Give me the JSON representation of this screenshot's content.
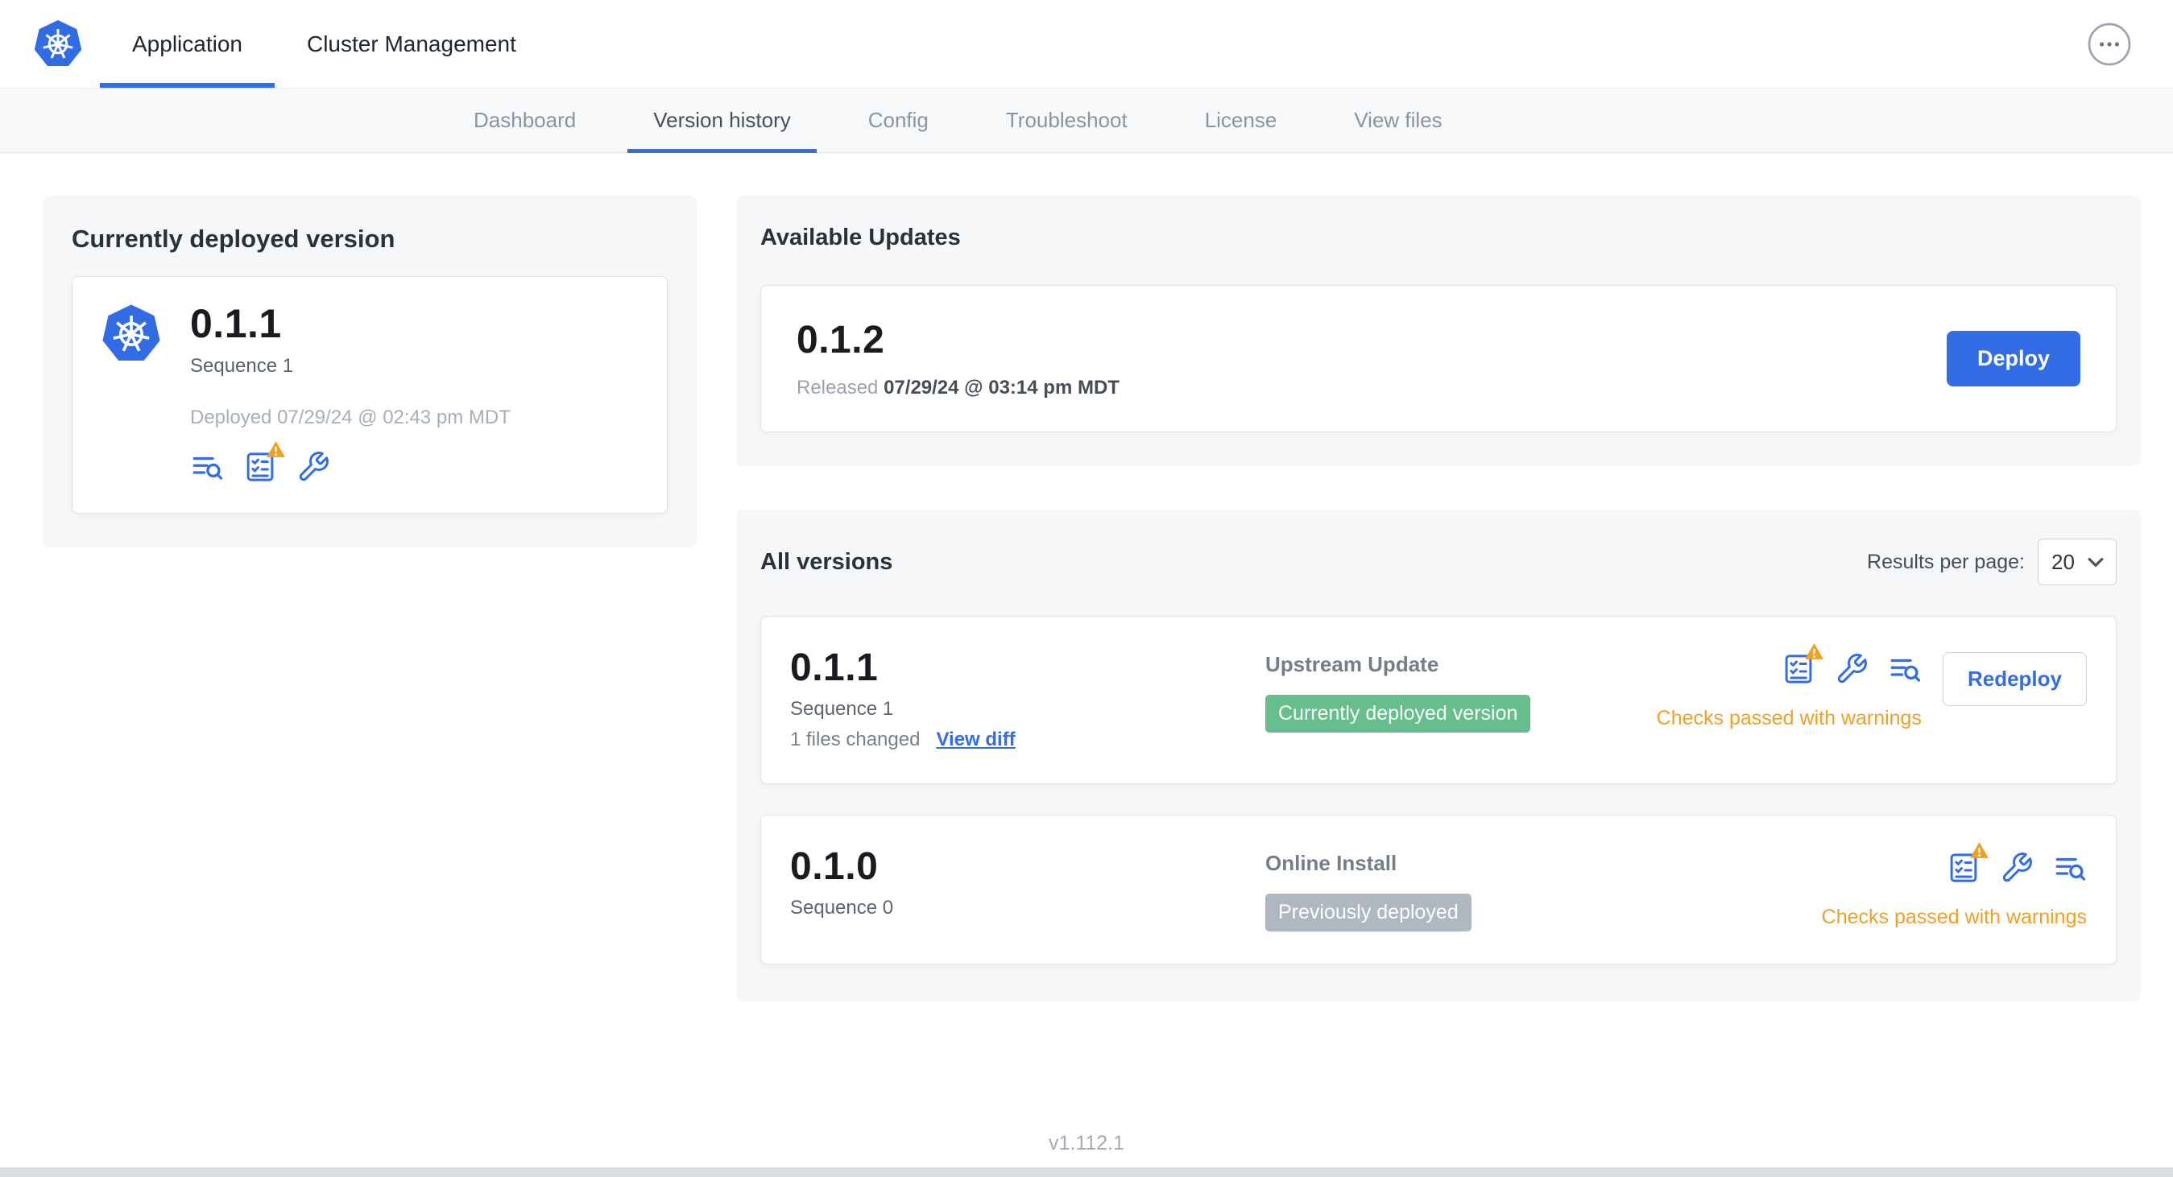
{
  "colors": {
    "accent_blue": "#326DE6",
    "badge_green": "#65BE8B",
    "badge_gray": "#AFB7C0",
    "warning_orange": "#F2A024"
  },
  "icons": {
    "app_logo": "kubernetes-helm-wheel",
    "overflow_menu": "ellipsis-in-circle",
    "release_notes": "text-lines-with-magnifier",
    "preflight_checks": "checklist-with-warning-triangle",
    "edit_config": "wrench",
    "select_chevron": "chevron-down"
  },
  "topnav": {
    "tabs": [
      {
        "label": "Application"
      },
      {
        "label": "Cluster Management"
      }
    ]
  },
  "subnav": {
    "items": [
      "Dashboard",
      "Version history",
      "Config",
      "Troubleshoot",
      "License",
      "View files"
    ],
    "active": "Version history"
  },
  "deployed_card": {
    "title": "Currently deployed version",
    "version": "0.1.1",
    "sequence": "Sequence 1",
    "deployed_at": "Deployed 07/29/24 @ 02:43 pm MDT"
  },
  "available_updates": {
    "title": "Available Updates",
    "version": "0.1.2",
    "released_label": "Released",
    "released_date": "07/29/24 @ 03:14 pm MDT",
    "deploy_button": "Deploy"
  },
  "all_versions": {
    "title": "All versions",
    "results_per_page_label": "Results per page:",
    "results_per_page_value": "20",
    "rows": [
      {
        "version": "0.1.1",
        "sequence": "Sequence 1",
        "files_changed": "1 files changed",
        "view_diff": "View diff",
        "source": "Upstream Update",
        "badge": "Currently deployed version",
        "status": "Checks passed with warnings",
        "action": "Redeploy"
      },
      {
        "version": "0.1.0",
        "sequence": "Sequence 0",
        "source": "Online Install",
        "badge": "Previously deployed",
        "status": "Checks passed with warnings"
      }
    ]
  },
  "footer": {
    "app_version": "v1.112.1"
  }
}
